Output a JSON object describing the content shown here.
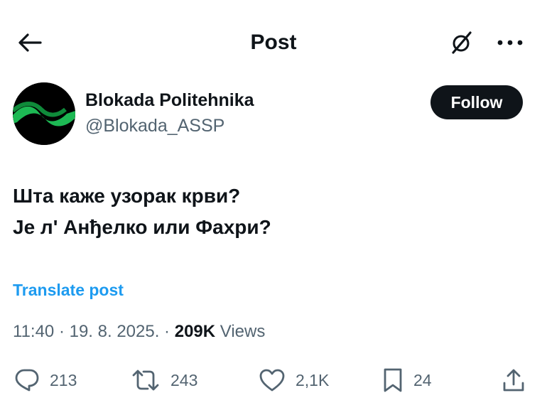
{
  "header": {
    "title": "Post",
    "icons": {
      "back": "arrow-left-icon",
      "grok": "grok-icon",
      "more": "more-horizontal-icon"
    }
  },
  "author": {
    "name": "Blokada Politehnika",
    "handle": "@Blokada_ASSP",
    "follow_label": "Follow",
    "avatar_colors": {
      "background": "#000000",
      "accent": "#1db954"
    }
  },
  "post": {
    "lines": [
      "Шта каже узорак крви?",
      "Је л' Анђелко или Фахри?"
    ],
    "translate_label": "Translate post",
    "time": "11:40",
    "date": "19. 8. 2025.",
    "views_count": "209K",
    "views_label": "Views"
  },
  "actions": {
    "replies": "213",
    "reposts": "243",
    "likes": "2,1K",
    "bookmarks": "24",
    "icons": [
      "reply-icon",
      "repost-icon",
      "like-icon",
      "bookmark-icon",
      "share-icon"
    ]
  },
  "colors": {
    "text": "#0f1419",
    "secondary": "#536471",
    "link": "#1d9bf0"
  }
}
